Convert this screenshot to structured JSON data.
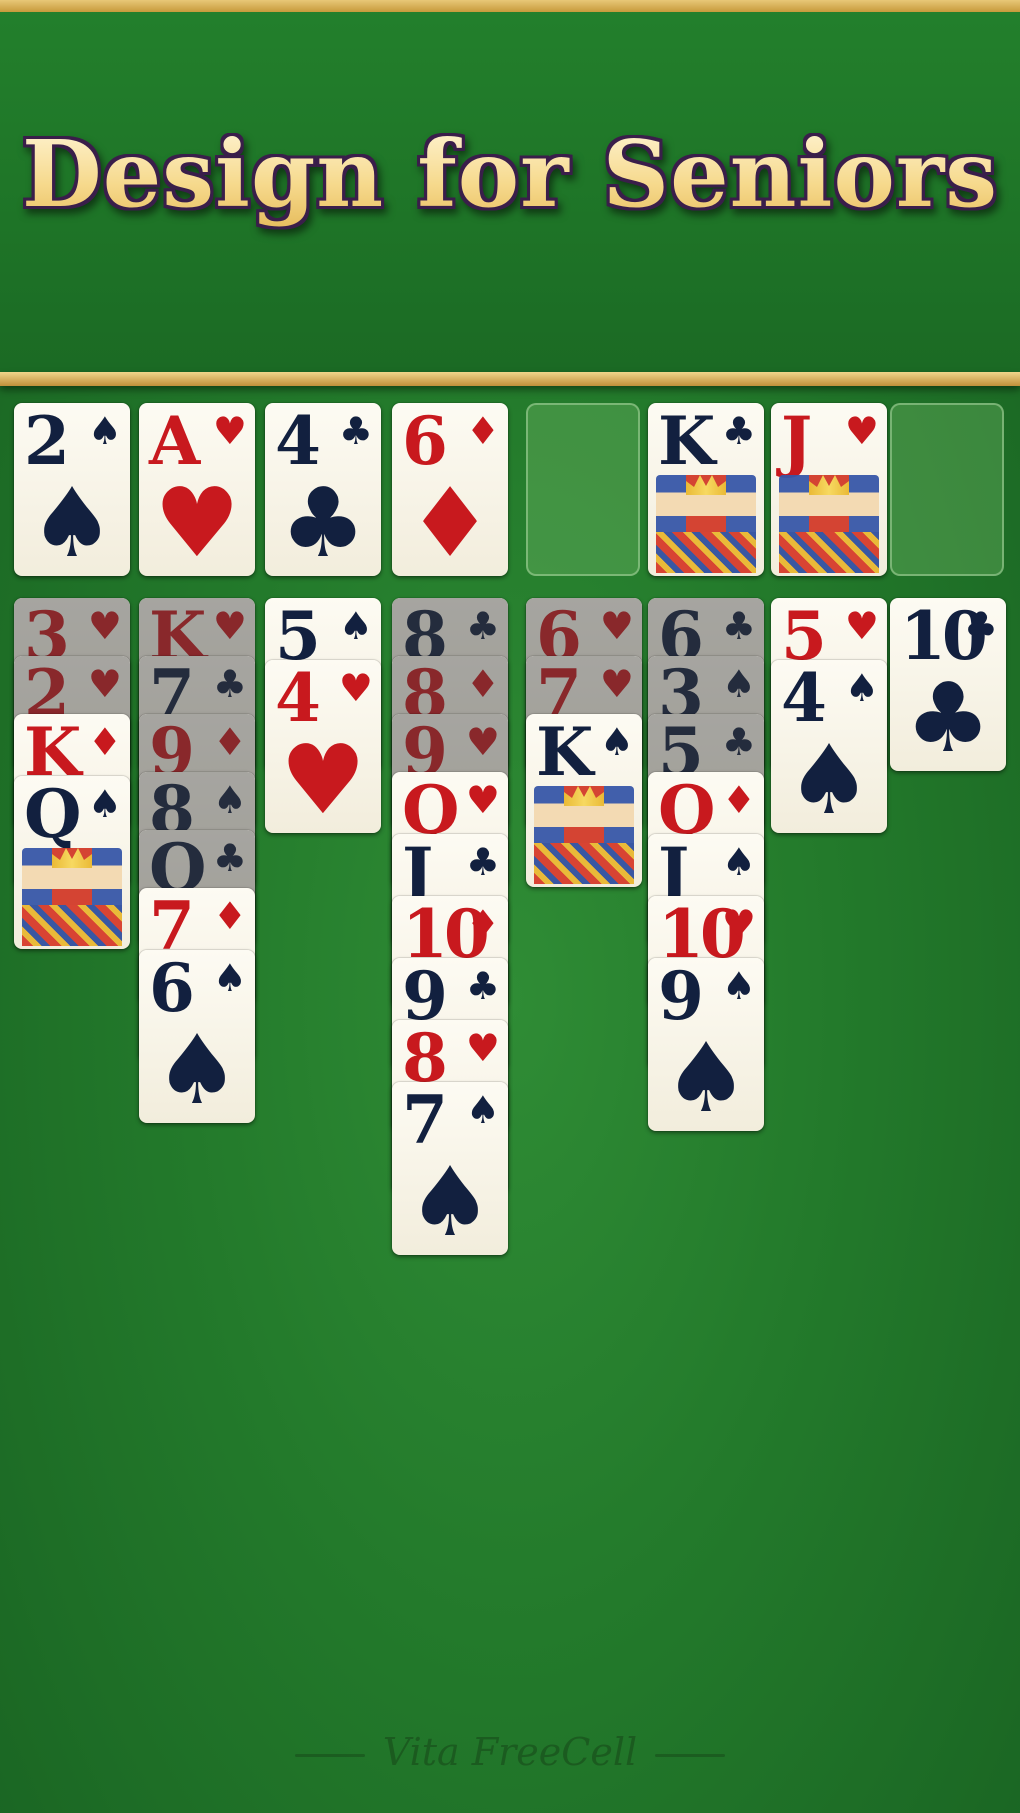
{
  "headline": "Design for Seniors",
  "brand": "Vita FreeCell",
  "colors": {
    "felt": "#237a2b",
    "gold": "#d9b05a",
    "red_suit": "#c8191e",
    "black_suit": "#12203f"
  },
  "foundations": [
    {
      "rank": "2",
      "suit": "♠",
      "color": "blk"
    },
    {
      "rank": "A",
      "suit": "♥",
      "color": "red"
    },
    {
      "rank": "4",
      "suit": "♣",
      "color": "blk"
    },
    {
      "rank": "6",
      "suit": "♦",
      "color": "red"
    }
  ],
  "free_cells": [
    null,
    {
      "rank": "K",
      "suit": "♣",
      "color": "blk",
      "face": true
    },
    {
      "rank": "J",
      "suit": "♥",
      "color": "red",
      "face": true
    },
    null
  ],
  "tableau": [
    [
      {
        "rank": "3",
        "suit": "♥",
        "color": "red",
        "dim": true
      },
      {
        "rank": "2",
        "suit": "♥",
        "color": "red",
        "dim": true
      },
      {
        "rank": "K",
        "suit": "♦",
        "color": "red"
      },
      {
        "rank": "Q",
        "suit": "♠",
        "color": "blk",
        "face": true
      }
    ],
    [
      {
        "rank": "K",
        "suit": "♥",
        "color": "red",
        "dim": true
      },
      {
        "rank": "7",
        "suit": "♣",
        "color": "blk",
        "dim": true
      },
      {
        "rank": "9",
        "suit": "♦",
        "color": "red",
        "dim": true
      },
      {
        "rank": "8",
        "suit": "♠",
        "color": "blk",
        "dim": true
      },
      {
        "rank": "Q",
        "suit": "♣",
        "color": "blk",
        "dim": true
      },
      {
        "rank": "7",
        "suit": "♦",
        "color": "red"
      },
      {
        "rank": "6",
        "suit": "♠",
        "color": "blk"
      }
    ],
    [
      {
        "rank": "5",
        "suit": "♠",
        "color": "blk"
      },
      {
        "rank": "4",
        "suit": "♥",
        "color": "red"
      }
    ],
    [
      {
        "rank": "8",
        "suit": "♣",
        "color": "blk",
        "dim": true
      },
      {
        "rank": "8",
        "suit": "♦",
        "color": "red",
        "dim": true
      },
      {
        "rank": "9",
        "suit": "♥",
        "color": "red",
        "dim": true
      },
      {
        "rank": "Q",
        "suit": "♥",
        "color": "red"
      },
      {
        "rank": "J",
        "suit": "♣",
        "color": "blk"
      },
      {
        "rank": "10",
        "suit": "♦",
        "color": "red"
      },
      {
        "rank": "9",
        "suit": "♣",
        "color": "blk"
      },
      {
        "rank": "8",
        "suit": "♥",
        "color": "red"
      },
      {
        "rank": "7",
        "suit": "♠",
        "color": "blk"
      }
    ],
    [
      {
        "rank": "6",
        "suit": "♥",
        "color": "red",
        "dim": true
      },
      {
        "rank": "7",
        "suit": "♥",
        "color": "red",
        "dim": true
      },
      {
        "rank": "K",
        "suit": "♠",
        "color": "blk",
        "face": true
      }
    ],
    [
      {
        "rank": "6",
        "suit": "♣",
        "color": "blk",
        "dim": true
      },
      {
        "rank": "3",
        "suit": "♠",
        "color": "blk",
        "dim": true
      },
      {
        "rank": "5",
        "suit": "♣",
        "color": "blk",
        "dim": true
      },
      {
        "rank": "Q",
        "suit": "♦",
        "color": "red"
      },
      {
        "rank": "J",
        "suit": "♠",
        "color": "blk"
      },
      {
        "rank": "10",
        "suit": "♥",
        "color": "red"
      },
      {
        "rank": "9",
        "suit": "♠",
        "color": "blk"
      }
    ],
    [
      {
        "rank": "5",
        "suit": "♥",
        "color": "red"
      },
      {
        "rank": "4",
        "suit": "♠",
        "color": "blk"
      }
    ],
    [
      {
        "rank": "10",
        "suit": "♣",
        "color": "blk"
      }
    ]
  ]
}
